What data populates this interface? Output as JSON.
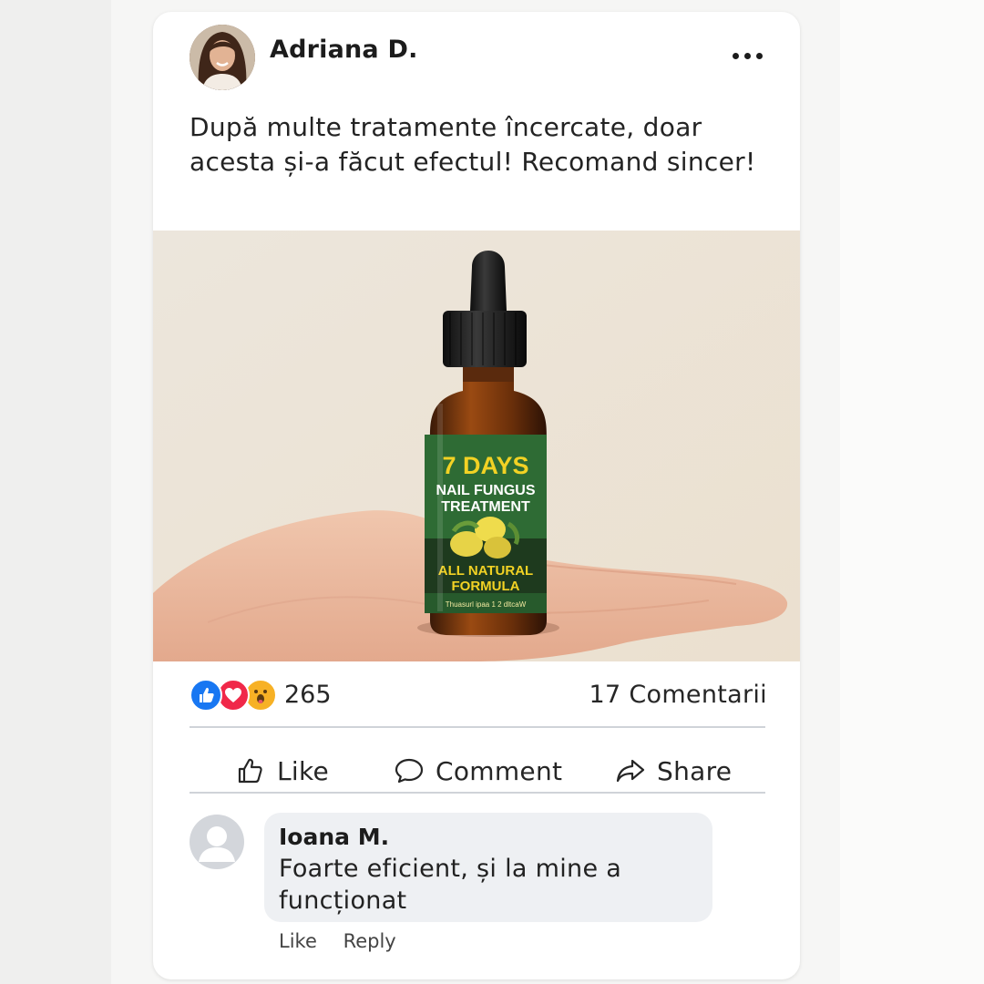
{
  "post": {
    "author": "Adriana D.",
    "text": "După multe tratamente încercate, doar acesta și-a făcut efectul! Recomand sincer!",
    "more_icon": "more-dots-icon"
  },
  "product": {
    "label_line1": "7 DAYS",
    "label_line2": "NAIL FUNGUS",
    "label_line3": "TREATMENT",
    "label_line4": "ALL NATURAL",
    "label_line5": "FORMULA",
    "label_footer": "Thuasurl ipaa   1 2 dltcaW"
  },
  "stats": {
    "reactions": [
      "like",
      "love",
      "wow"
    ],
    "reaction_count": "265",
    "comments": "17 Comentarii"
  },
  "actions": {
    "like": "Like",
    "comment": "Comment",
    "share": "Share"
  },
  "comment": {
    "author": "Ioana M.",
    "text": "Foarte eficient, și la mine a funcționat",
    "like": "Like",
    "reply": "Reply"
  },
  "colors": {
    "like_blue": "#1877f2",
    "love_red": "#f02849",
    "wow_yellow": "#f7b125",
    "label_green": "#2e6b34",
    "label_yellow": "#f2d224"
  }
}
